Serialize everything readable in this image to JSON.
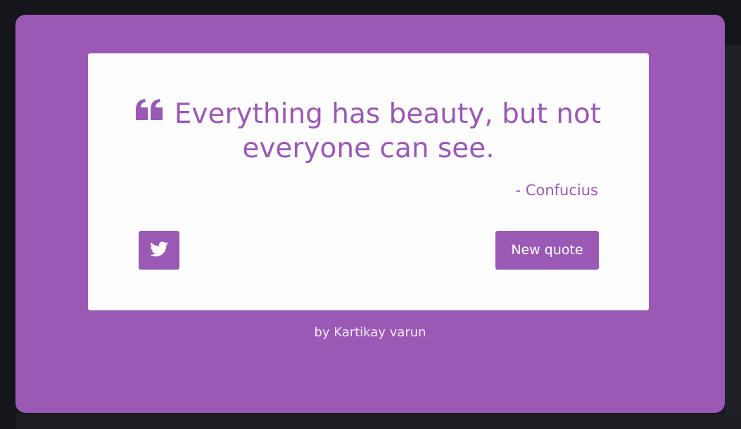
{
  "quote": {
    "text": "Everything has beauty, but not everyone can see.",
    "author": "- Confucius",
    "icon": "quote-left-icon"
  },
  "actions": {
    "tweet_icon": "twitter-icon",
    "new_quote_label": "New quote"
  },
  "footer": {
    "prefix": "by ",
    "author": "Kartikay varun"
  },
  "colors": {
    "accent": "#9a59b5",
    "card": "#fdfdfd",
    "background": "#15161b"
  }
}
